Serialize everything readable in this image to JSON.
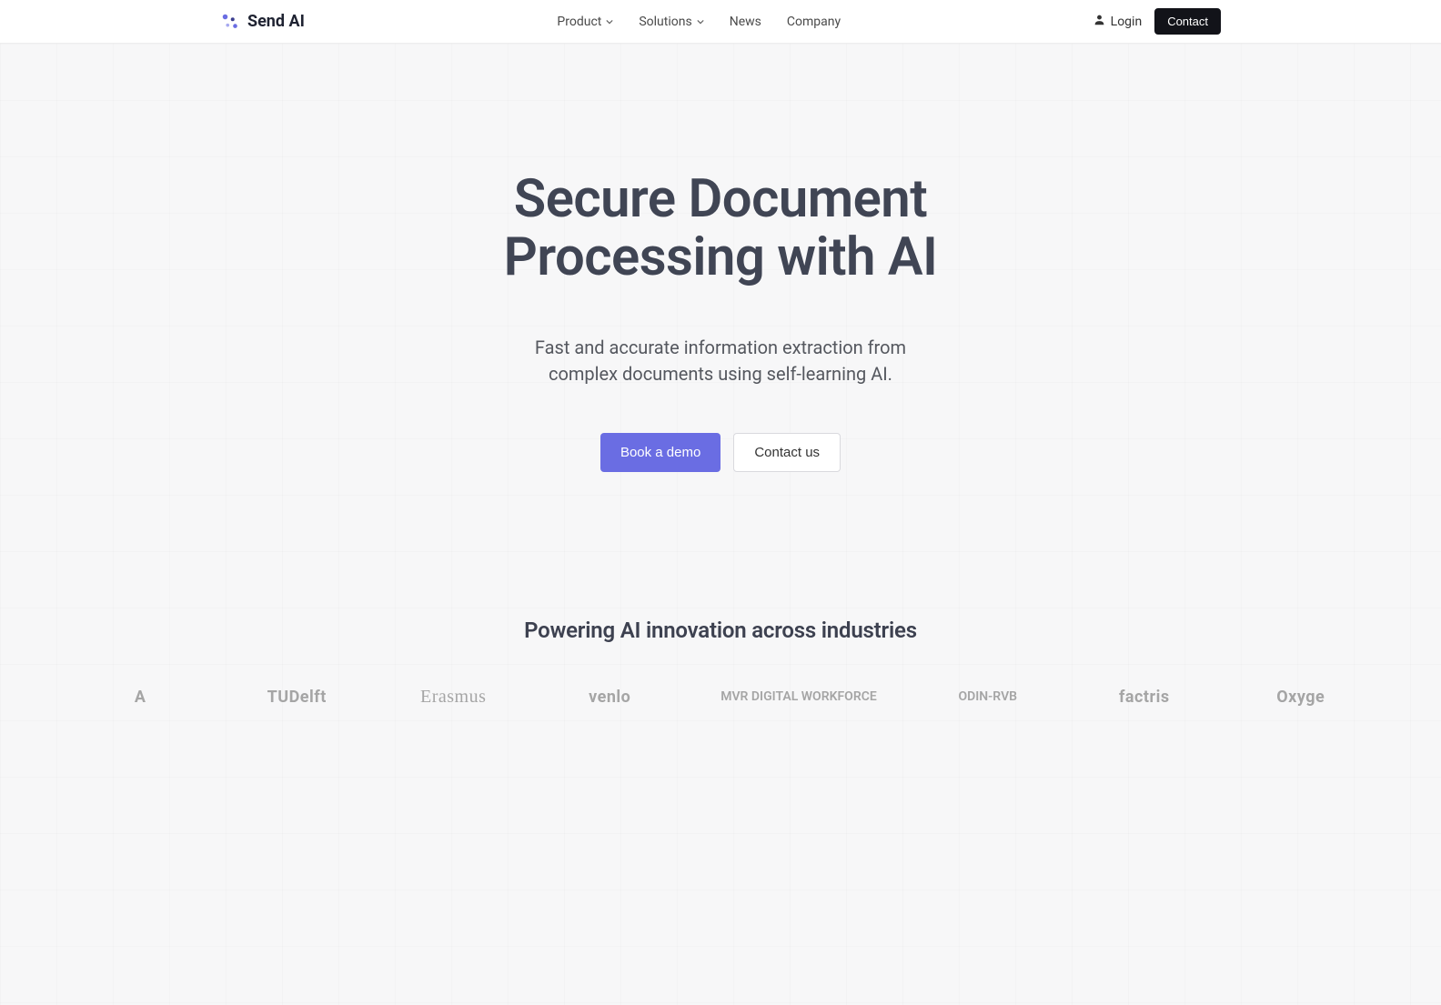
{
  "header": {
    "brand": "Send AI",
    "nav": {
      "product": "Product",
      "solutions": "Solutions",
      "news": "News",
      "company": "Company"
    },
    "login": "Login",
    "contact": "Contact"
  },
  "hero": {
    "title_line1": "Secure Document",
    "title_line2": "Processing with AI",
    "subtitle_line1": "Fast and accurate information extraction from",
    "subtitle_line2": "complex documents using self-learning AI.",
    "cta_primary": "Book a demo",
    "cta_secondary": "Contact us"
  },
  "partners": {
    "heading": "Powering AI innovation across industries",
    "logos": [
      "A",
      "TUDelft",
      "Erasmus",
      "venlo",
      "MVR DIGITAL WORKFORCE",
      "ODIN-RVB",
      "factris",
      "Oxyge"
    ]
  },
  "colors": {
    "accent": "#6a6de3",
    "dark": "#121319"
  }
}
